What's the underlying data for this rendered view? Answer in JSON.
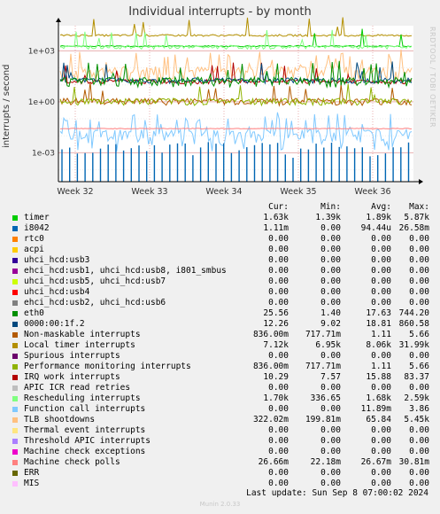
{
  "title": "Individual interrupts - by month",
  "side_credit": "RRDTOOL / TOBI OETIKER",
  "version": "Munin 2.0.33",
  "last_update": "Last update:  Sun Sep  8 07:00:02 2024",
  "legend_headers": [
    "Cur:",
    "Min:",
    "Avg:",
    "Max:"
  ],
  "legend": [
    {
      "name": "timer",
      "color": "#00cc00",
      "cur": "1.63k",
      "min": "1.39k",
      "avg": "1.89k",
      "max": "5.87k"
    },
    {
      "name": "i8042",
      "color": "#0066b3",
      "cur": "1.11m",
      "min": "0.00",
      "avg": "94.44u",
      "max": "26.58m"
    },
    {
      "name": "rtc0",
      "color": "#ff8000",
      "cur": "0.00",
      "min": "0.00",
      "avg": "0.00",
      "max": "0.00"
    },
    {
      "name": "acpi",
      "color": "#ffcc00",
      "cur": "0.00",
      "min": "0.00",
      "avg": "0.00",
      "max": "0.00"
    },
    {
      "name": "uhci_hcd:usb3",
      "color": "#330099",
      "cur": "0.00",
      "min": "0.00",
      "avg": "0.00",
      "max": "0.00"
    },
    {
      "name": "ehci_hcd:usb1, uhci_hcd:usb8, i801_smbus",
      "color": "#990099",
      "cur": "0.00",
      "min": "0.00",
      "avg": "0.00",
      "max": "0.00"
    },
    {
      "name": "uhci_hcd:usb5, uhci_hcd:usb7",
      "color": "#ccff00",
      "cur": "0.00",
      "min": "0.00",
      "avg": "0.00",
      "max": "0.00"
    },
    {
      "name": "uhci_hcd:usb4",
      "color": "#ff0000",
      "cur": "0.00",
      "min": "0.00",
      "avg": "0.00",
      "max": "0.00"
    },
    {
      "name": "ehci_hcd:usb2, uhci_hcd:usb6",
      "color": "#808080",
      "cur": "0.00",
      "min": "0.00",
      "avg": "0.00",
      "max": "0.00"
    },
    {
      "name": "eth0",
      "color": "#008f00",
      "cur": "25.56",
      "min": "1.40",
      "avg": "17.63",
      "max": "744.20"
    },
    {
      "name": "0000:00:1f.2",
      "color": "#00487d",
      "cur": "12.26",
      "min": "9.02",
      "avg": "18.81",
      "max": "860.58"
    },
    {
      "name": "Non-maskable interrupts",
      "color": "#b35a00",
      "cur": "836.00m",
      "min": "717.71m",
      "avg": "1.11",
      "max": "5.66"
    },
    {
      "name": "Local timer interrupts",
      "color": "#b38f00",
      "cur": "7.12k",
      "min": "6.95k",
      "avg": "8.06k",
      "max": "31.99k"
    },
    {
      "name": "Spurious interrupts",
      "color": "#6b006b",
      "cur": "0.00",
      "min": "0.00",
      "avg": "0.00",
      "max": "0.00"
    },
    {
      "name": "Performance monitoring interrupts",
      "color": "#8fb300",
      "cur": "836.00m",
      "min": "717.71m",
      "avg": "1.11",
      "max": "5.66"
    },
    {
      "name": "IRQ work interrupts",
      "color": "#b30000",
      "cur": "10.29",
      "min": "7.57",
      "avg": "15.88",
      "max": "83.37"
    },
    {
      "name": "APIC ICR read retries",
      "color": "#bebebe",
      "cur": "0.00",
      "min": "0.00",
      "avg": "0.00",
      "max": "0.00"
    },
    {
      "name": "Rescheduling interrupts",
      "color": "#80ff80",
      "cur": "1.70k",
      "min": "336.65",
      "avg": "1.68k",
      "max": "2.59k"
    },
    {
      "name": "Function call interrupts",
      "color": "#80c9ff",
      "cur": "0.00",
      "min": "0.00",
      "avg": "11.89m",
      "max": "3.86"
    },
    {
      "name": "TLB shootdowns",
      "color": "#ffc080",
      "cur": "322.02m",
      "min": "199.81m",
      "avg": "65.84",
      "max": "5.45k"
    },
    {
      "name": "Thermal event interrupts",
      "color": "#ffe680",
      "cur": "0.00",
      "min": "0.00",
      "avg": "0.00",
      "max": "0.00"
    },
    {
      "name": "Threshold APIC interrupts",
      "color": "#aa80ff",
      "cur": "0.00",
      "min": "0.00",
      "avg": "0.00",
      "max": "0.00"
    },
    {
      "name": "Machine check exceptions",
      "color": "#ee00cc",
      "cur": "0.00",
      "min": "0.00",
      "avg": "0.00",
      "max": "0.00"
    },
    {
      "name": "Machine check polls",
      "color": "#ff8080",
      "cur": "26.66m",
      "min": "22.18m",
      "avg": "26.67m",
      "max": "30.81m"
    },
    {
      "name": "ERR",
      "color": "#666600",
      "cur": "0.00",
      "min": "0.00",
      "avg": "0.00",
      "max": "0.00"
    },
    {
      "name": "MIS",
      "color": "#ffbfff",
      "cur": "0.00",
      "min": "0.00",
      "avg": "0.00",
      "max": "0.00"
    }
  ],
  "chart_data": {
    "type": "line",
    "title": "Individual interrupts - by month",
    "ylabel": "interrupts / second",
    "yscale": "log",
    "y_ticks": [
      "1e+03",
      "1e+00",
      "1e-03"
    ],
    "y_tick_values": [
      1000,
      1,
      0.001
    ],
    "ylim": [
      2e-05,
      30000
    ],
    "x_ticks": [
      "Week 32",
      "Week 33",
      "Week 34",
      "Week 35",
      "Week 36"
    ],
    "grid": true,
    "series": [
      {
        "name": "Local timer interrupts",
        "color": "#b38f00",
        "approx": 8060
      },
      {
        "name": "timer",
        "color": "#00cc00",
        "approx": 1890
      },
      {
        "name": "Rescheduling interrupts",
        "color": "#80ff80",
        "approx": 1680
      },
      {
        "name": "TLB shootdowns",
        "color": "#ffc080",
        "approx": 65.84
      },
      {
        "name": "eth0",
        "color": "#008f00",
        "approx": 17.63
      },
      {
        "name": "0000:00:1f.2",
        "color": "#00487d",
        "approx": 18.81
      },
      {
        "name": "IRQ work interrupts",
        "color": "#b30000",
        "approx": 15.88
      },
      {
        "name": "Non-maskable interrupts",
        "color": "#b35a00",
        "approx": 1.11
      },
      {
        "name": "Performance monitoring interrupts",
        "color": "#8fb300",
        "approx": 1.11
      },
      {
        "name": "Machine check polls",
        "color": "#ff8080",
        "approx": 0.02667
      },
      {
        "name": "Function call interrupts",
        "color": "#80c9ff",
        "approx": 0.01189
      },
      {
        "name": "i8042",
        "color": "#0066b3",
        "approx": 9.44e-05
      }
    ]
  }
}
